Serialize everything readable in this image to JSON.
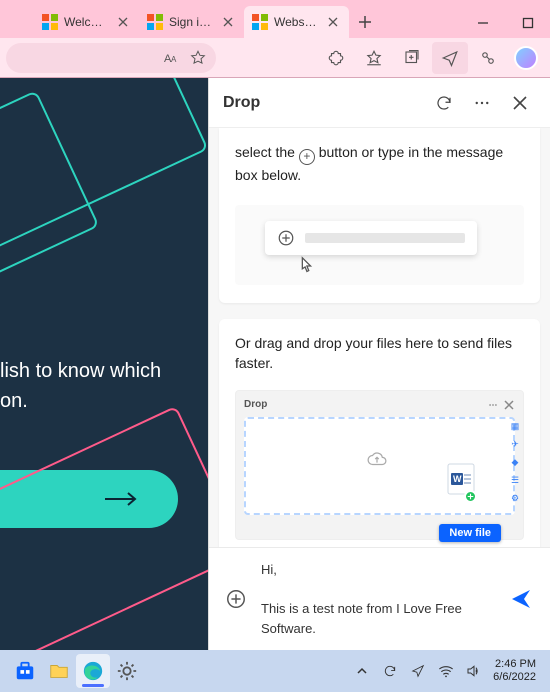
{
  "tabs": [
    {
      "label": "Welcome to t",
      "icon": "edge-favicon"
    },
    {
      "label": "Sign in to Mic",
      "icon": "ms-favicon"
    },
    {
      "label": "Website Them",
      "icon": "edge-favicon",
      "active": true
    }
  ],
  "page": {
    "text_line1": "lish to know which",
    "text_line2": "on."
  },
  "drop": {
    "title": "Drop",
    "card1": {
      "pre": "select the",
      "post": "button or type in the message box below."
    },
    "card2": {
      "text": "Or drag and drop your files here to send files faster.",
      "mini_title": "Drop",
      "new_file_label": "New file"
    },
    "compose": {
      "line1": "Hi,",
      "line2": "This is a test note from I Love Free Software."
    }
  },
  "tray": {
    "time": "2:46 PM",
    "date": "6/6/2022"
  }
}
